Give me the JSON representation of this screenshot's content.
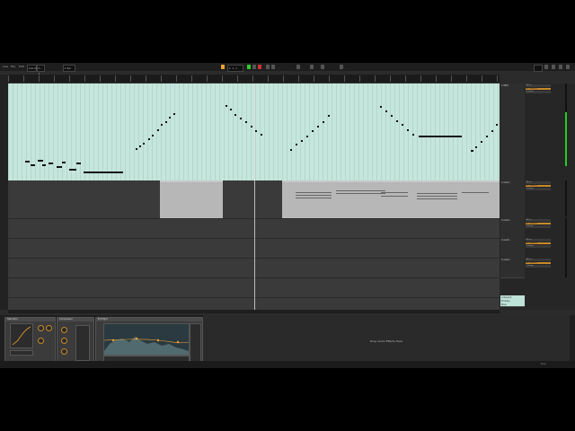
{
  "window": {
    "menus": [
      "Live",
      "File",
      "Edit",
      "Create",
      "View",
      "Options",
      "Help"
    ]
  },
  "transport": {
    "tempo": "120.00",
    "time_sig": "4 / 4",
    "position": "1. 1. 1",
    "quantize": "1 Bar"
  },
  "tracks": [
    {
      "name": "1 MIDI"
    },
    {
      "name": "2 Audio"
    },
    {
      "name": "3 Audio"
    },
    {
      "name": "4 Audio"
    },
    {
      "name": "5 Audio"
    },
    {
      "name": "A Reverb"
    },
    {
      "name": "B Delay"
    },
    {
      "name": "Main"
    }
  ],
  "send_labels": [
    "All Ins",
    "All Channels",
    "1 Group"
  ],
  "devices": [
    {
      "title": "Saturator"
    },
    {
      "title": "Compressor"
    },
    {
      "title": "EQ Eight"
    }
  ],
  "drop_text": "Drop Audio Effects Here",
  "status": {
    "right_label": "Main"
  },
  "colors": {
    "midi_clip": "#c5e6dc",
    "accent": "#f0a030",
    "audio_clip": "#b7b7b7"
  }
}
